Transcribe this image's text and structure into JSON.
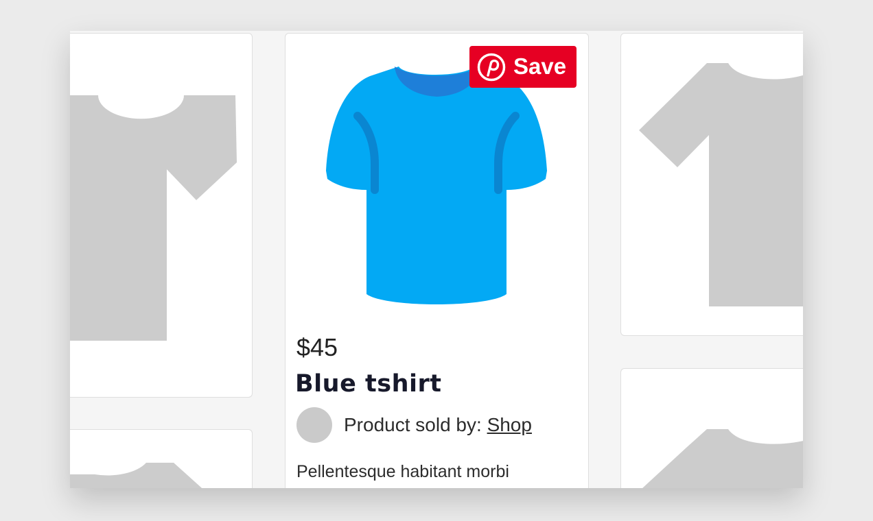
{
  "product": {
    "price": "$45",
    "title": "Blue tshirt",
    "seller_prefix": "Product sold by: ",
    "seller_link": "Shop",
    "description": "Pellentesque habitant morbi tristique senectus et netus et",
    "image_icon": "blue-tshirt",
    "shirt_color": "#03a9f4",
    "collar_color": "#1e7fd9"
  },
  "save_button": {
    "label": "Save",
    "icon": "pinterest-logo",
    "color": "#e60023"
  },
  "placeholder": {
    "icon": "tshirt-placeholder",
    "color": "#cccccc"
  },
  "background_color": "#f5f5f5"
}
